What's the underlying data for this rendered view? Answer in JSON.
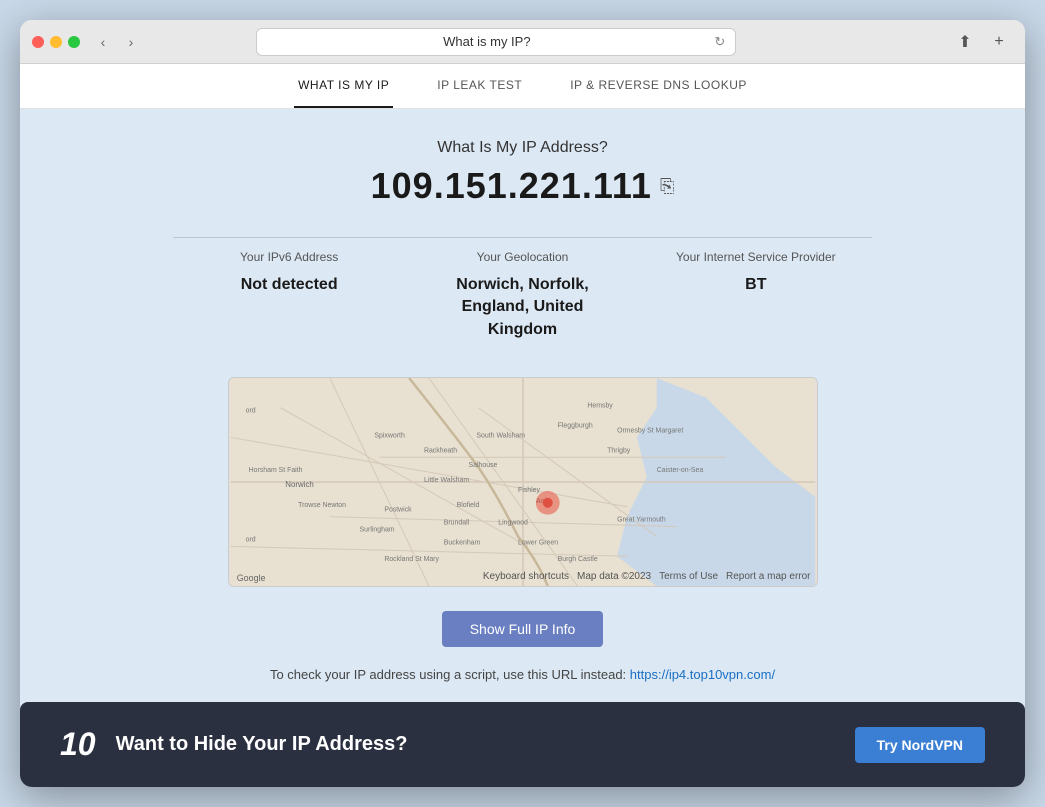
{
  "browser": {
    "address_bar_text": "What is my IP?",
    "nav_back": "‹",
    "nav_forward": "›",
    "refresh": "↻",
    "tab_plus": "+"
  },
  "nav": {
    "items": [
      {
        "label": "What Is My IP",
        "active": true
      },
      {
        "label": "IP Leak Test",
        "active": false
      },
      {
        "label": "IP & Reverse DNS Lookup",
        "active": false
      }
    ]
  },
  "main": {
    "page_title": "What Is My IP Address?",
    "ip_address": "109.151.221.111",
    "copy_icon_label": "⎘",
    "cards": [
      {
        "label": "Your IPv6 Address",
        "value": "Not detected"
      },
      {
        "label": "Your Geolocation",
        "value": "Norwich, Norfolk, England, United Kingdom"
      },
      {
        "label": "Your Internet Service Provider",
        "value": "BT"
      }
    ],
    "map": {
      "google_label": "Google",
      "keyboard_shortcuts": "Keyboard shortcuts",
      "map_data": "Map data ©2023",
      "terms": "Terms of Use",
      "report": "Report a map error"
    },
    "show_ip_button": "Show Full IP Info",
    "script_info_text": "To check your IP address using a script, use this URL instead:",
    "script_link": "https://ip4.top10vpn.com/",
    "hide_banner": {
      "title": "Want to Hide Your IP Address?",
      "logo": "10",
      "button_label": "Try NordVPN"
    }
  }
}
